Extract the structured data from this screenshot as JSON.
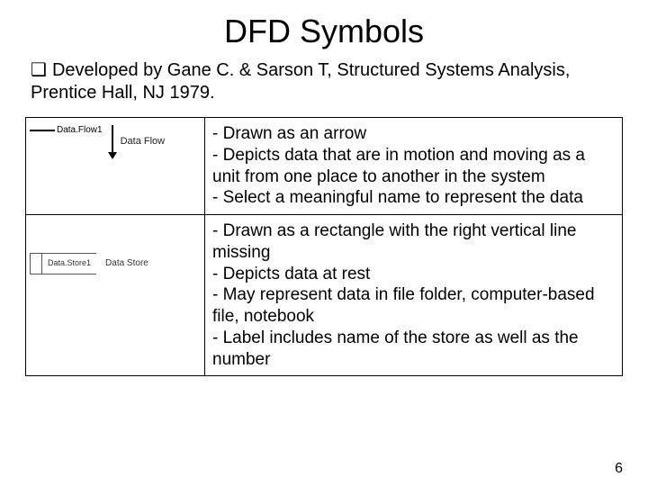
{
  "title": "DFD Symbols",
  "intro_bullet_symbol": "❑",
  "intro_text": "Developed by Gane C. & Sarson T, Structured Systems Analysis, Prentice Hall, NJ 1979.",
  "rows": [
    {
      "diagram": {
        "flow_text": "Data.Flow1",
        "flow_label": "Data Flow"
      },
      "points": [
        "- Drawn as an arrow",
        "- Depicts data that are in motion and moving as a unit from one place to another in the system",
        "- Select a meaningful name to represent the data"
      ]
    },
    {
      "diagram": {
        "store_text": "Data.Store1",
        "store_label": "Data Store"
      },
      "points": [
        "- Drawn as a rectangle with the right vertical line missing",
        "- Depicts data at rest",
        "- May represent data in file folder, computer-based file, notebook",
        "- Label includes name of the store as well as the number"
      ]
    }
  ],
  "page_number": "6"
}
